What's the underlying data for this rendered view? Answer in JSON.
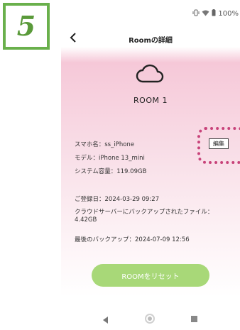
{
  "step": {
    "number": "5",
    "color": "#6ab04c"
  },
  "status_bar": {
    "icons": [
      "vibrate-icon",
      "wifi-icon",
      "battery-icon"
    ],
    "battery": "100%"
  },
  "header": {
    "back_icon": "chevron-left-icon",
    "title": "Roomの詳細"
  },
  "room": {
    "icon": "cloud-icon",
    "name": "ROOM 1"
  },
  "device": {
    "smartphone_name": "スマホ名：ss_iPhone",
    "model": "モデル：iPhone 13_mini",
    "system_capacity": "システム容量：119.09GB",
    "edit_label": "編集"
  },
  "details": {
    "registered": "ご登録日：2024-03-29 09:27",
    "backup_files": "クラウドサーバーにバックアップされたファイル：4.42GB",
    "last_backup": "最後のバックアップ：2024-07-09 12:56"
  },
  "actions": {
    "reset_label": "ROOMをリセット"
  },
  "colors": {
    "accent_green": "#a8d878",
    "highlight_pink": "#c8437a",
    "background_pink": "#f6c8d8"
  },
  "nav_bar": {
    "icons": [
      "nav-back-icon",
      "nav-home-icon",
      "nav-recent-icon"
    ]
  }
}
